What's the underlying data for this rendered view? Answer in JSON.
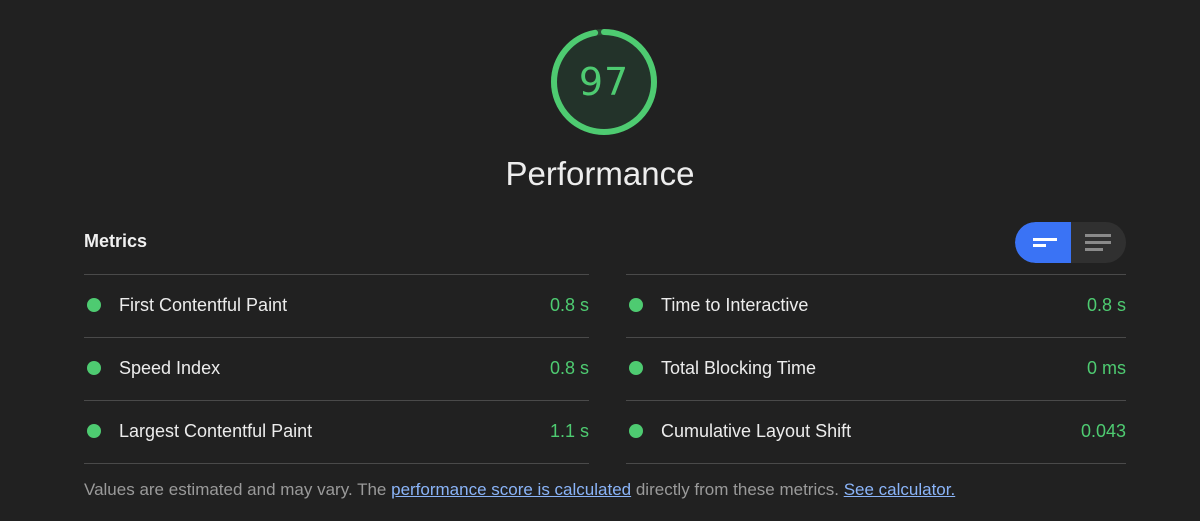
{
  "score": {
    "value": "97",
    "fraction": 0.97,
    "color": "#4ecb71"
  },
  "category": {
    "title": "Performance"
  },
  "metrics": {
    "header": "Metrics",
    "left": [
      {
        "name": "First Contentful Paint",
        "value": "0.8 s"
      },
      {
        "name": "Speed Index",
        "value": "0.8 s"
      },
      {
        "name": "Largest Contentful Paint",
        "value": "1.1 s"
      }
    ],
    "right": [
      {
        "name": "Time to Interactive",
        "value": "0.8 s"
      },
      {
        "name": "Total Blocking Time",
        "value": "0 ms"
      },
      {
        "name": "Cumulative Layout Shift",
        "value": "0.043"
      }
    ],
    "status_color": "#4ecb71"
  },
  "view_toggle": {
    "active": "collapsed-view",
    "icons": [
      "collapsed-view-icon",
      "expanded-view-icon"
    ],
    "accent": "#3a73f5"
  },
  "footnote": {
    "text_before": "Values are estimated and may vary. The ",
    "link_score": "performance score is calculated",
    "text_middle": " directly from these metrics. ",
    "link_calculator": "See calculator."
  }
}
